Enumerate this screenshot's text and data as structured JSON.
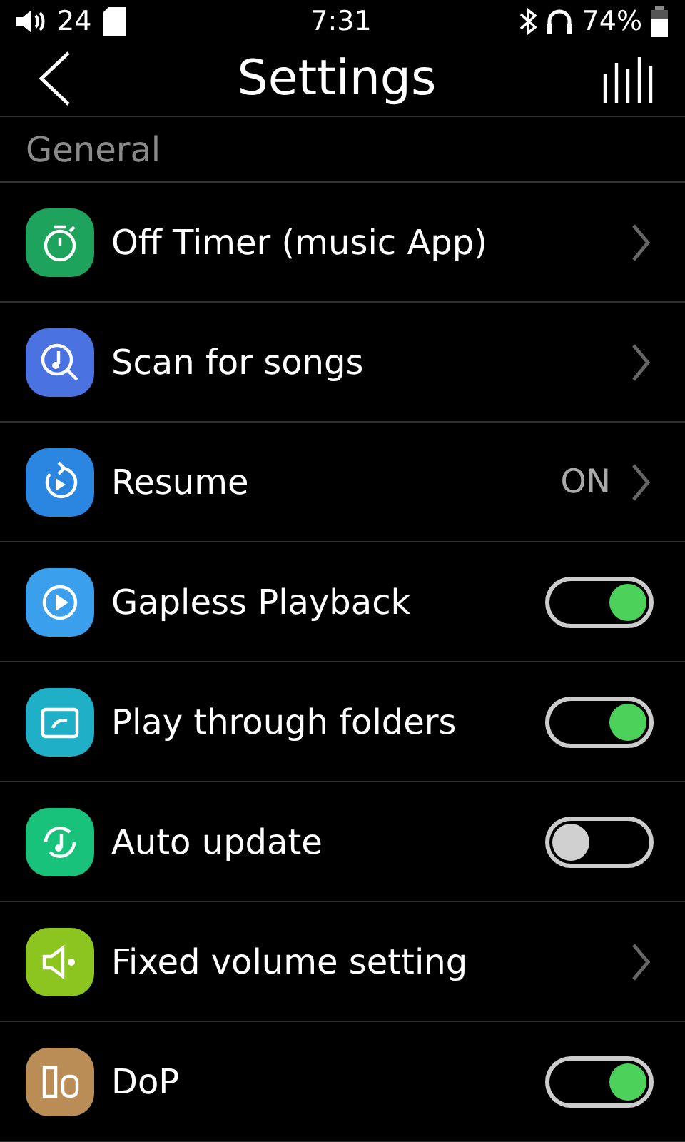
{
  "status_bar": {
    "volume": "24",
    "time": "7:31",
    "battery": "74%"
  },
  "header": {
    "title": "Settings"
  },
  "section": "General",
  "items": [
    {
      "kind": "link",
      "label": "Off Timer (music App)",
      "color": "#1ea35c"
    },
    {
      "kind": "link",
      "label": "Scan for songs",
      "color": "#4a72e0"
    },
    {
      "kind": "value",
      "label": "Resume",
      "value": "ON",
      "color": "#2a86e0"
    },
    {
      "kind": "toggle",
      "label": "Gapless Playback",
      "on": true,
      "color": "#3aa0ee"
    },
    {
      "kind": "toggle",
      "label": "Play through folders",
      "on": true,
      "color": "#1fb0c8"
    },
    {
      "kind": "toggle",
      "label": "Auto update",
      "on": false,
      "color": "#18c27a"
    },
    {
      "kind": "link",
      "label": "Fixed volume setting",
      "color": "#8cc520"
    },
    {
      "kind": "toggle",
      "label": "DoP",
      "on": true,
      "color": "#b98d55"
    }
  ]
}
